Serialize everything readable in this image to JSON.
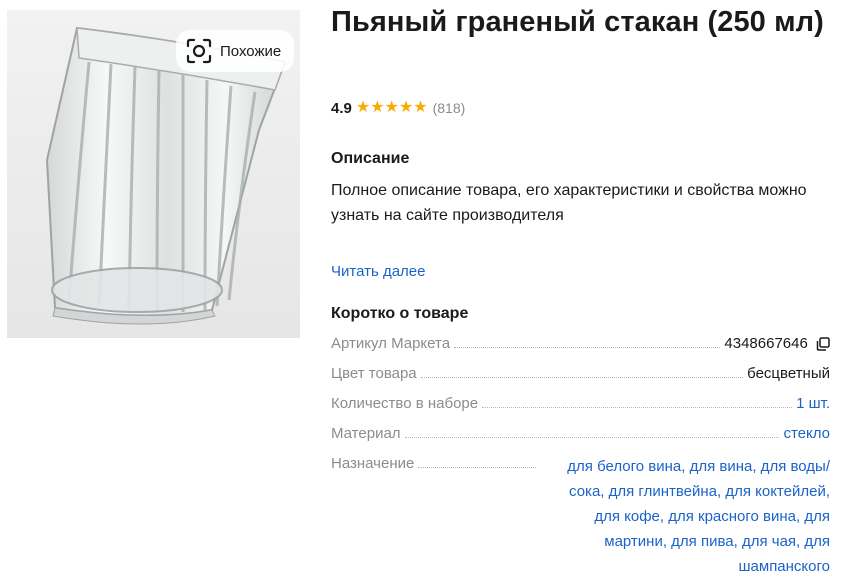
{
  "product": {
    "title": "Пьяный граненый стакан (250 мл)",
    "image_alt": "glass-photo",
    "similar_label": "Похожие"
  },
  "rating": {
    "value": "4.9",
    "stars": 5,
    "count": "(818)",
    "star_color": "#f8ac00"
  },
  "description": {
    "heading": "Описание",
    "text": "Полное описание товара, его характеристики и свойства можно узнать на сайте производителя",
    "read_more": "Читать далее"
  },
  "specs": {
    "heading": "Коротко о товаре",
    "rows": [
      {
        "label": "Артикул Маркета",
        "value": "4348667646",
        "link": false,
        "copy_icon": true
      },
      {
        "label": "Цвет товара",
        "value": "бесцветный",
        "link": false
      },
      {
        "label": "Количество в наборе",
        "value": "1 шт.",
        "link": true
      },
      {
        "label": "Материал",
        "value": "стекло",
        "link": true
      },
      {
        "label": "Назначение",
        "value": "для белого вина, для вина, для воды/ сока, для глинтвейна, для коктейлей, для кофе, для красного вина, для мартини, для пива, для чая, для шампанского",
        "link": true
      }
    ]
  },
  "colors": {
    "link": "#1b63c9",
    "muted": "#8c8c8c",
    "text": "#1a1a1a"
  }
}
